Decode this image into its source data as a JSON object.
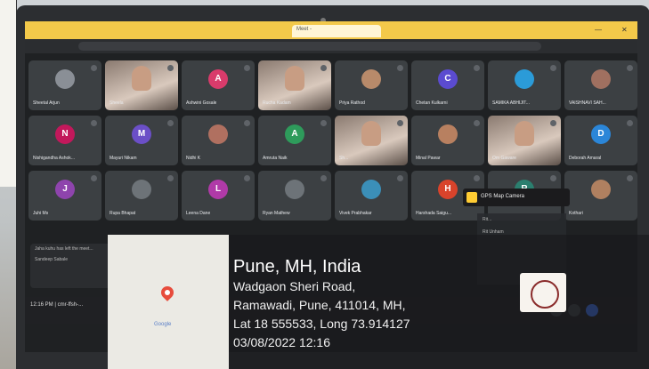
{
  "browser": {
    "tabs": [
      {
        "label": ""
      },
      {
        "label": ""
      },
      {
        "label": "Meet - "
      },
      {
        "label": ""
      }
    ],
    "address": ""
  },
  "participants": [
    {
      "name": "Sheetal Arjun",
      "initial": "",
      "color": "#8a8f96",
      "video": false
    },
    {
      "name": "Sheela",
      "initial": "",
      "color": "",
      "video": true
    },
    {
      "name": "Ashwini Gosale",
      "initial": "A",
      "color": "#d93b6b",
      "video": false
    },
    {
      "name": "Rucha Kadam",
      "initial": "",
      "color": "",
      "video": true
    },
    {
      "name": "Priya Rathod",
      "initial": "",
      "color": "#b88a6a",
      "video": false
    },
    {
      "name": "Chetan Kulkarni",
      "initial": "C",
      "color": "#5b4bd0",
      "video": false
    },
    {
      "name": "SAMIKA ABHIJIT...",
      "initial": "",
      "color": "#2b9bd8",
      "video": false
    },
    {
      "name": "VAISHNAVI SAH...",
      "initial": "",
      "color": "#a07060",
      "video": false
    },
    {
      "name": "Nishigandha Ashok...",
      "initial": "N",
      "color": "#c2185b",
      "video": false
    },
    {
      "name": "Mayuri Nikam",
      "initial": "M",
      "color": "#6b4fc7",
      "video": false
    },
    {
      "name": "Nidhi K",
      "initial": "",
      "color": "#b07060",
      "video": false
    },
    {
      "name": "Amruta Naik",
      "initial": "A",
      "color": "#2e9b5b",
      "video": false
    },
    {
      "name": "Sh...",
      "initial": "",
      "color": "",
      "video": true
    },
    {
      "name": "Minal Pawar",
      "initial": "",
      "color": "#b88060",
      "video": false
    },
    {
      "name": "Om Gaware",
      "initial": "",
      "color": "",
      "video": true
    },
    {
      "name": "Deborah Amaral",
      "initial": "D",
      "color": "#2b86d8",
      "video": false
    },
    {
      "name": "Juhi Ms",
      "initial": "J",
      "color": "#8e44ad",
      "video": false
    },
    {
      "name": "Rupa Bhapat",
      "initial": "",
      "color": "#6d7378",
      "video": false
    },
    {
      "name": "Leena Dane",
      "initial": "L",
      "color": "#b03aa8",
      "video": false
    },
    {
      "name": "Ryan Mathew",
      "initial": "",
      "color": "#6d7378",
      "video": false
    },
    {
      "name": "Vivek Prabhakar",
      "initial": "",
      "color": "#3b8fb8",
      "video": false
    },
    {
      "name": "Harshada Saigu...",
      "initial": "H",
      "color": "#d8432b",
      "video": false
    },
    {
      "name": "",
      "initial": "R",
      "color": "#2b7f6f",
      "video": false
    },
    {
      "name": "Kothari",
      "initial": "",
      "color": "#b08060",
      "video": false
    }
  ],
  "chat": {
    "line1": "Jaha kuhu has left the meet...",
    "line2": "Sandeep Sabale",
    "time": "12:16 PM | cmr-ffsh-..."
  },
  "gps_app": {
    "label": "GPS Map Camera"
  },
  "side_panel": {
    "item1": "Rit...",
    "item2": "Rit Unham"
  },
  "geo": {
    "city": "Pune, MH, India",
    "street": "Wadgaon Sheri Road,",
    "area": "Ramawadi, Pune, 411014, MH,",
    "coords": "Lat 18 555533, Long 73.914127",
    "datetime": "03/08/2022 12:16",
    "map_brand": "Google"
  }
}
